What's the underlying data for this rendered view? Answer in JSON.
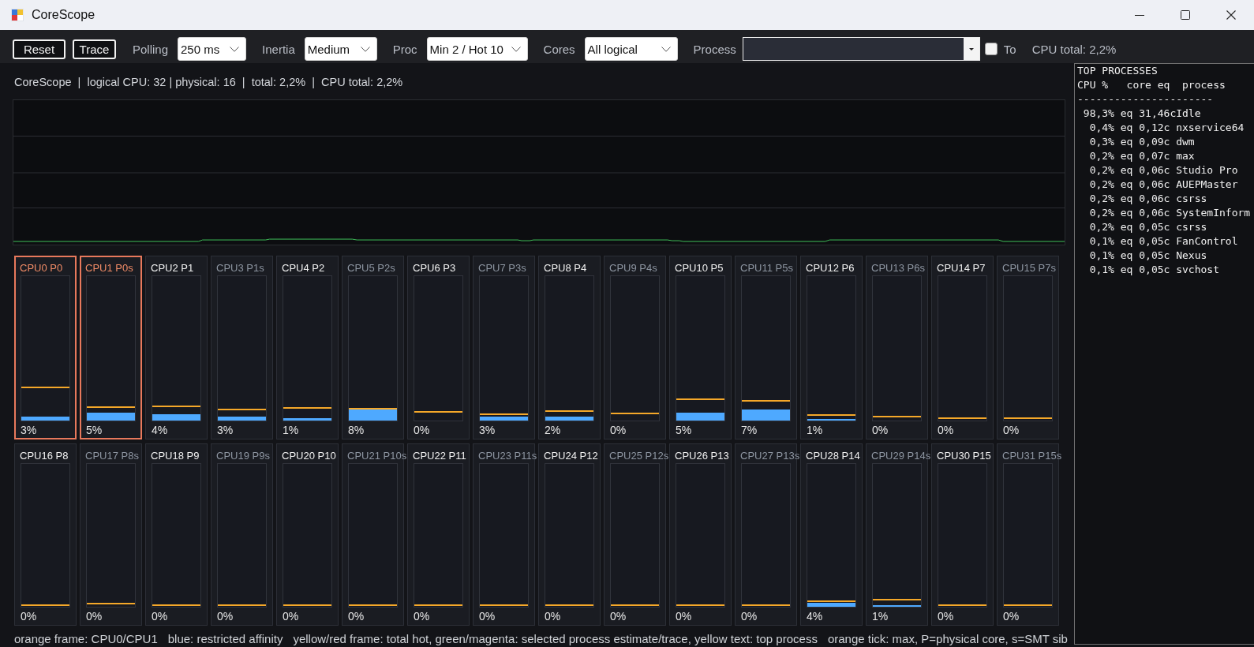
{
  "window": {
    "title": "CoreScope"
  },
  "toolbar": {
    "buttons": [
      "Reset",
      "Trace"
    ],
    "dropdowns": [
      {
        "label": "Polling",
        "value": "250 ms"
      },
      {
        "label": "Inertia",
        "value": "Medium"
      },
      {
        "label": "Proc",
        "value": "Min 2 / Hot 10"
      },
      {
        "label": "Cores",
        "value": "All logical"
      }
    ],
    "process_picker": {
      "label": "Process"
    },
    "to_checkbox": {
      "label": "To",
      "checked": false
    },
    "cpu_total": "CPU total: 2,2%"
  },
  "status_line": "CoreScope  |  logical CPU: 32 | physical: 16  |  total: 2,2%  |  CPU total: 2,2%",
  "cores": [
    {
      "label": "CPU0 P0",
      "smt": false,
      "framed": true,
      "usage": {
        "level": 0.03
      },
      "peak": {
        "level": 0.23
      },
      "reading": "3%"
    },
    {
      "label": "CPU1 P0s",
      "smt": true,
      "framed": true,
      "usage": {
        "level": 0.056
      },
      "peak": {
        "level": 0.095
      },
      "reading": "5%"
    },
    {
      "label": "CPU2 P1",
      "smt": false,
      "framed": false,
      "usage": {
        "level": 0.044
      },
      "peak": {
        "level": 0.1
      },
      "reading": "4%"
    },
    {
      "label": "CPU3 P1s",
      "smt": true,
      "framed": false,
      "usage": {
        "level": 0.026
      },
      "peak": {
        "level": 0.074
      },
      "reading": "3%"
    },
    {
      "label": "CPU4 P2",
      "smt": false,
      "framed": false,
      "usage": {
        "level": 0.014
      },
      "peak": {
        "level": 0.086
      },
      "reading": "1%"
    },
    {
      "label": "CPU5 P2s",
      "smt": true,
      "framed": false,
      "usage": {
        "level": 0.077
      },
      "peak": {
        "level": 0.08
      },
      "reading": "8%"
    },
    {
      "label": "CPU6 P3",
      "smt": false,
      "framed": false,
      "peak": {
        "level": 0.058
      },
      "reading": "0%"
    },
    {
      "label": "CPU7 P3s",
      "smt": true,
      "framed": false,
      "usage": {
        "level": 0.026
      },
      "peak": {
        "level": 0.042
      },
      "reading": "3%"
    },
    {
      "label": "CPU8 P4",
      "smt": false,
      "framed": false,
      "usage": {
        "level": 0.03
      },
      "peak": {
        "level": 0.065
      },
      "reading": "2%"
    },
    {
      "label": "CPU9 P4s",
      "smt": true,
      "framed": false,
      "peak": {
        "level": 0.05
      },
      "reading": "0%"
    },
    {
      "label": "CPU10 P5",
      "smt": false,
      "framed": false,
      "usage": {
        "level": 0.054
      },
      "peak": {
        "level": 0.147
      },
      "reading": "5%"
    },
    {
      "label": "CPU11 P5s",
      "smt": true,
      "framed": false,
      "usage": {
        "level": 0.076
      },
      "peak": {
        "level": 0.136
      },
      "reading": "7%"
    },
    {
      "label": "CPU12 P6",
      "smt": false,
      "framed": false,
      "usage": {
        "level": 0.01
      },
      "peak": {
        "level": 0.038
      },
      "reading": "1%"
    },
    {
      "label": "CPU13 P6s",
      "smt": true,
      "framed": false,
      "peak": {
        "level": 0.027
      },
      "reading": "0%"
    },
    {
      "label": "CPU14 P7",
      "smt": false,
      "framed": false,
      "peak": {
        "level": 0.016
      },
      "reading": "0%"
    },
    {
      "label": "CPU15 P7s",
      "smt": true,
      "framed": false,
      "peak": {
        "level": 0.016
      },
      "reading": "0%"
    },
    {
      "label": "CPU16 P8",
      "smt": false,
      "framed": false,
      "peak": {
        "level": 0.01
      },
      "reading": "0%"
    },
    {
      "label": "CPU17 P8s",
      "smt": true,
      "framed": false,
      "peak": {
        "level": 0.02
      },
      "reading": "0%"
    },
    {
      "label": "CPU18 P9",
      "smt": false,
      "framed": false,
      "peak": {
        "level": 0.01
      },
      "reading": "0%"
    },
    {
      "label": "CPU19 P9s",
      "smt": true,
      "framed": false,
      "peak": {
        "level": 0.01
      },
      "reading": "0%"
    },
    {
      "label": "CPU20 P10",
      "smt": false,
      "framed": false,
      "peak": {
        "level": 0.01
      },
      "reading": "0%"
    },
    {
      "label": "CPU21 P10s",
      "smt": true,
      "framed": false,
      "peak": {
        "level": 0.01
      },
      "reading": "0%"
    },
    {
      "label": "CPU22 P11",
      "smt": false,
      "framed": false,
      "peak": {
        "level": 0.01
      },
      "reading": "0%"
    },
    {
      "label": "CPU23 P11s",
      "smt": true,
      "framed": false,
      "peak": {
        "level": 0.01
      },
      "reading": "0%"
    },
    {
      "label": "CPU24 P12",
      "smt": false,
      "framed": false,
      "peak": {
        "level": 0.01
      },
      "reading": "0%"
    },
    {
      "label": "CPU25 P12s",
      "smt": true,
      "framed": false,
      "peak": {
        "level": 0.01
      },
      "reading": "0%"
    },
    {
      "label": "CPU26 P13",
      "smt": false,
      "framed": false,
      "peak": {
        "level": 0.01
      },
      "reading": "0%"
    },
    {
      "label": "CPU27 P13s",
      "smt": true,
      "framed": false,
      "peak": {
        "level": 0.01
      },
      "reading": "0%"
    },
    {
      "label": "CPU28 P14",
      "smt": false,
      "framed": false,
      "usage": {
        "level": 0.028
      },
      "peak": {
        "level": 0.036
      },
      "reading": "4%"
    },
    {
      "label": "CPU29 P14s",
      "smt": true,
      "framed": false,
      "usage": {
        "level": 0.01
      },
      "peak": {
        "level": 0.05
      },
      "reading": "1%"
    },
    {
      "label": "CPU30 P15",
      "smt": false,
      "framed": false,
      "peak": {
        "level": 0.01
      },
      "reading": "0%"
    },
    {
      "label": "CPU31 P15s",
      "smt": true,
      "framed": false,
      "peak": {
        "level": 0.01
      },
      "reading": "0%"
    }
  ],
  "legend": [
    "orange frame: CPU0/CPU1",
    "blue: restricted affinity",
    "yellow/red frame: total hot, green/magenta: selected process estimate/trace, yellow text: top process",
    "orange tick: max, P=physical core, s=SMT sib"
  ],
  "top_processes": {
    "title": "TOP PROCESSES",
    "columns": [
      "CPU %",
      "core eq",
      "process"
    ],
    "separator": "----------------------",
    "rows": [
      {
        "cpu": "98,3%",
        "core_eq": "eq 31,46c",
        "process": "Idle"
      },
      {
        "cpu": "0,4%",
        "core_eq": "eq 0,12c",
        "process": "nxservice64"
      },
      {
        "cpu": "0,3%",
        "core_eq": "eq 0,09c",
        "process": "dwm"
      },
      {
        "cpu": "0,2%",
        "core_eq": "eq 0,07c",
        "process": "max"
      },
      {
        "cpu": "0,2%",
        "core_eq": "eq 0,06c",
        "process": "Studio Pro"
      },
      {
        "cpu": "0,2%",
        "core_eq": "eq 0,06c",
        "process": "AUEPMaster"
      },
      {
        "cpu": "0,2%",
        "core_eq": "eq 0,06c",
        "process": "csrss"
      },
      {
        "cpu": "0,2%",
        "core_eq": "eq 0,06c",
        "process": "SystemInform"
      },
      {
        "cpu": "0,2%",
        "core_eq": "eq 0,05c",
        "process": "csrss"
      },
      {
        "cpu": "0,1%",
        "core_eq": "eq 0,05c",
        "process": "FanControl"
      },
      {
        "cpu": "0,1%",
        "core_eq": "eq 0,05c",
        "process": "Nexus"
      },
      {
        "cpu": "0,1%",
        "core_eq": "eq 0,05c",
        "process": "svchost"
      }
    ]
  }
}
